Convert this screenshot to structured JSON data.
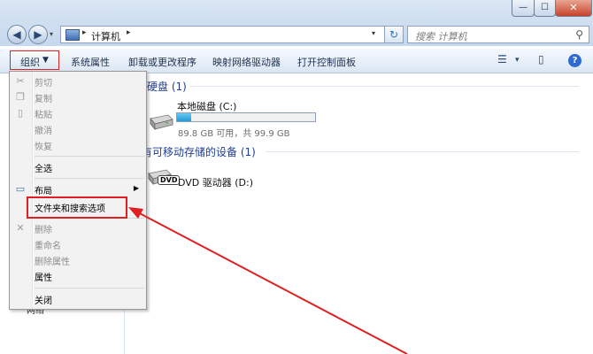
{
  "window": {
    "controls": {
      "minimize": "—",
      "maximize": "☐",
      "close": "✕"
    }
  },
  "address": {
    "path": "计算机",
    "sep1": "▸",
    "sep2": "▸",
    "dropdown": "▾",
    "refresh": "↻"
  },
  "search": {
    "placeholder": "搜索 计算机",
    "icon": "⚲"
  },
  "toolbar": {
    "organize": "组织",
    "organize_arrow": "▼",
    "items": [
      "系统属性",
      "卸载或更改程序",
      "映射网络驱动器",
      "打开控制面板"
    ],
    "view_icon": "☰",
    "view_arrow": "▾",
    "preview_icon": "▯",
    "help_icon": "?"
  },
  "content": {
    "group_hdd": "硬盘 (1)",
    "drive_c": "本地磁盘 (C:)",
    "drive_c_free": "89.8 GB 可用，共 99.9 GB",
    "drive_c_used_fraction": 0.1,
    "group_removable": "有可移动存储的设备 (1)",
    "drive_d": "DVD 驱动器 (D:)",
    "dvd_logo": "DVD",
    "nav_network": "网络"
  },
  "menu": {
    "cut": "剪切",
    "copy": "复制",
    "paste": "粘贴",
    "undo": "撤消",
    "redo": "恢复",
    "select_all": "全选",
    "layout": "布局",
    "layout_arrow": "▶",
    "folder_options": "文件夹和搜索选项",
    "delete": "删除",
    "rename": "重命名",
    "remove_props": "删除属性",
    "properties": "属性",
    "close": "关闭"
  },
  "colors": {
    "highlight_red": "#e02020",
    "title_blue": "#1e3d8f",
    "capacity_fill": "#1f9ad4"
  }
}
